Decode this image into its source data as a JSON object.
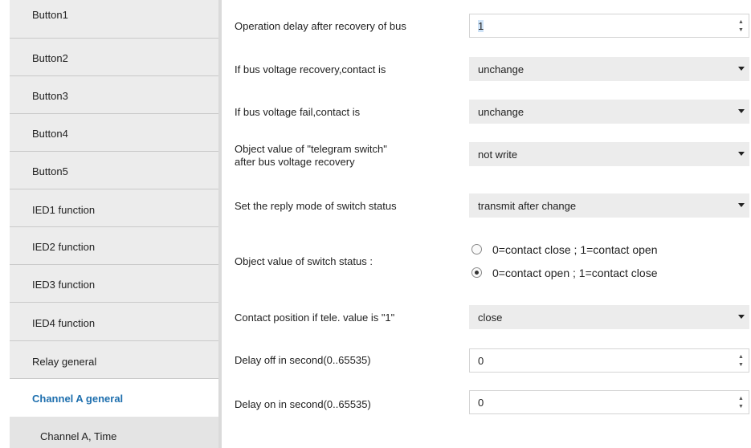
{
  "sidebar": {
    "items": [
      {
        "label": "Button1"
      },
      {
        "label": "Button2"
      },
      {
        "label": "Button3"
      },
      {
        "label": "Button4"
      },
      {
        "label": "Button5"
      },
      {
        "label": "IED1 function"
      },
      {
        "label": "IED2 function"
      },
      {
        "label": "IED3 function"
      },
      {
        "label": "IED4 function"
      },
      {
        "label": "Relay general"
      },
      {
        "label": "Channel A general"
      },
      {
        "label": "Channel A, Time"
      }
    ],
    "active_item": "Channel A general"
  },
  "form": {
    "operation_delay": {
      "label": "Operation delay after recovery of bus",
      "value": "1"
    },
    "bus_recovery": {
      "label": "If bus voltage recovery,contact is",
      "value": "unchange"
    },
    "bus_fail": {
      "label": "If bus voltage fail,contact is",
      "value": "unchange"
    },
    "telegram_switch": {
      "label_line1": "Object value of \"telegram switch\"",
      "label_line2": "after bus voltage recovery",
      "value": "not write"
    },
    "reply_mode": {
      "label": "Set the reply mode of switch status",
      "value": "transmit after change"
    },
    "switch_status": {
      "label": "Object value of switch status :",
      "options": [
        "0=contact close ; 1=contact open",
        "0=contact open ; 1=contact close"
      ],
      "selected_index": 1
    },
    "contact_position": {
      "label": "Contact position if tele. value is \"1\"",
      "value": "close"
    },
    "delay_off": {
      "label": "Delay off in second(0..65535)",
      "value": "0"
    },
    "delay_on": {
      "label": "Delay on in second(0..65535)",
      "value": "0"
    }
  },
  "icons": {
    "dropdown": "chevron-down-icon",
    "spinner": "spinner-arrows-icon",
    "radio": "radio-button-icon"
  },
  "colors": {
    "active_nav_text": "#1e6fae",
    "sidebar_bg": "#ececec",
    "control_bg": "#ececec"
  }
}
